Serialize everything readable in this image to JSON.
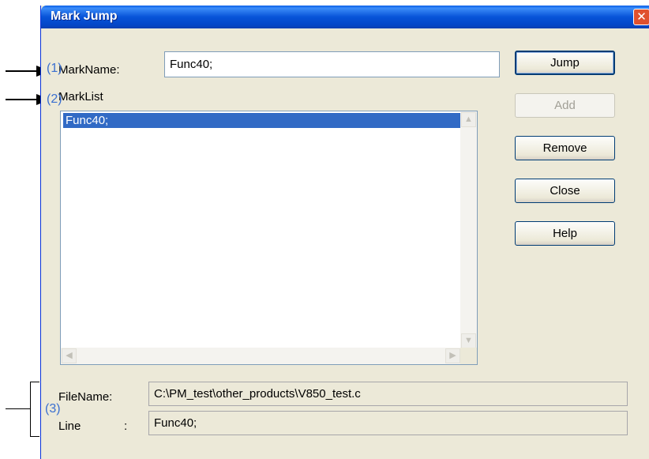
{
  "dialog": {
    "title": "Mark Jump",
    "close_glyph": "✕"
  },
  "mark_name": {
    "label": "MarkName:",
    "value": "Func40;"
  },
  "mark_list": {
    "label": "MarkList",
    "items": [
      "Func40;"
    ]
  },
  "buttons": {
    "jump": "Jump",
    "add": "Add",
    "remove": "Remove",
    "close": "Close",
    "help": "Help"
  },
  "file_name": {
    "label": "FileName:",
    "value": "C:\\PM_test\\other_products\\V850_test.c"
  },
  "line": {
    "label": "Line",
    "sep": ":",
    "value": "Func40;"
  },
  "annotations": {
    "a1": "(1)",
    "a2": "(2)",
    "a3": "(3)"
  },
  "icons": [
    "close-icon",
    "scroll-up-icon",
    "scroll-down-icon",
    "scroll-left-icon",
    "scroll-right-icon",
    "arrow-icon"
  ]
}
